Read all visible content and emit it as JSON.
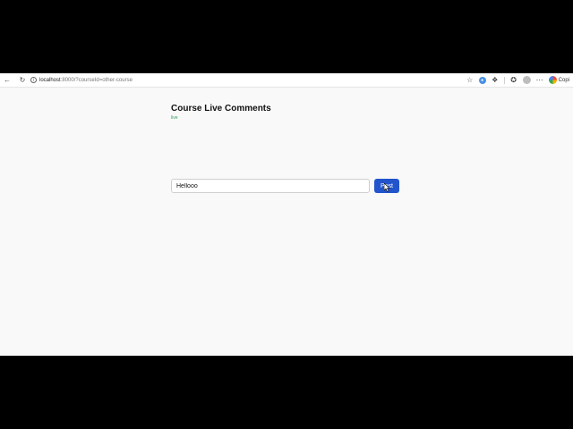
{
  "browser": {
    "url_host": "localhost",
    "url_rest": ":8000/?courseId=other-course",
    "copilot_label": "Copi"
  },
  "page": {
    "title": "Course Live Comments",
    "status": "live"
  },
  "comment_form": {
    "input_value": "Hellooo",
    "post_label": "Post"
  },
  "colors": {
    "accent": "#2255cc",
    "status": "#2e9e5b",
    "background": "#f9f9f9"
  },
  "icons": [
    "back-icon",
    "reload-icon",
    "info-icon",
    "star-icon",
    "extension-icon",
    "puzzle-icon",
    "favorites-icon",
    "profile-icon",
    "more-icon",
    "copilot-icon"
  ]
}
